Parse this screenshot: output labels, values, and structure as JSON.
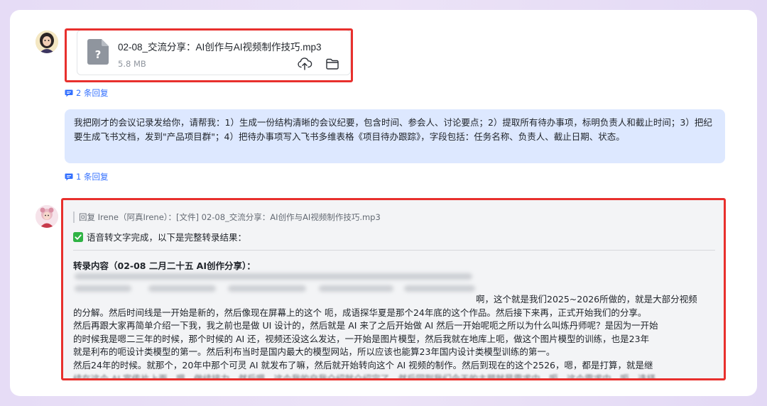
{
  "colors": {
    "accent": "#3370ff",
    "highlight_border": "#e8302d",
    "bubble_bg": "#dde8ff",
    "message_bg": "#f3f4f6"
  },
  "file_message": {
    "icon": "unknown-file-icon",
    "file_name": "02-08_交流分享：AI创作与AI视频制作技巧.mp3",
    "file_size": "5.8 MB",
    "upload_icon": "cloud-upload-icon",
    "folder_icon": "folder-icon"
  },
  "thread1": {
    "reply_label": "2 条回复",
    "icon": "reply-thread-icon"
  },
  "request_message": {
    "text": "我把刚才的会议记录发给你，请帮我：1）生成一份结构清晰的会议纪要，包含时间、参会人、讨论要点；2）提取所有待办事项，标明负责人和截止时间；3）把纪要生成飞书文档，发到\"产品项目群\"；4）把待办事项写入飞书多维表格《项目待办跟踪》，字段包括：任务名称、负责人、截止日期、状态。"
  },
  "thread2": {
    "reply_label": "1 条回复",
    "icon": "reply-thread-icon"
  },
  "bot_message": {
    "quote": "回复 Irene（阿真Irene）：[文件] 02-08_交流分享：AI创作与AI视频制作技巧.mp3",
    "status_icon": "check-mark-icon",
    "status_text": "语音转文字完成，以下是完整转录结果：",
    "section_title": "转录内容（02-08 二月二十五 AI创作分享）：",
    "first_line_tail": "啊，这个就是我们2025~2026所做的，就是大部分视频",
    "lines": [
      "的分解。然后时间线是一开始是新的，然后像现在屏幕上的这个 呃，成语探华夏是那个24年底的这个作品。然后接下来再，正式开始我们的分享。",
      "然后再跟大家再简单介绍一下我，我之前也是做 UI 设计的，然后就是 AI 来了之后开始做 AI 然后一开始呢呃之所以为什么叫炼丹师呢？是因为一开始",
      "的时候我是嗯二三年的时候，那个时候的 AI 还，视频还没这么发达，一开始是图片模型，然后我就在地库上呃，做这个图片模型的训练，也是23年",
      "就是利布的呃设计类模型的第一。然后利布当时是国内最大的模型网站，所以应该也能算23年国内设计类模型训练的第一。",
      "然后24年的时候。就那个，20年中那个可灵 AI 就发布了嘛，然后就开始转向这个 AI 视频的制作。然后到现在的这个2526，嗯，都是打算，就是继",
      "续在这个 AI 宣传片上面，嗯，做续接力。然后嗯，这个我的自我介绍就介绍完了，然后回到我们今天的主题就是需求中。呃，这个需求中，呃，选择"
    ]
  }
}
